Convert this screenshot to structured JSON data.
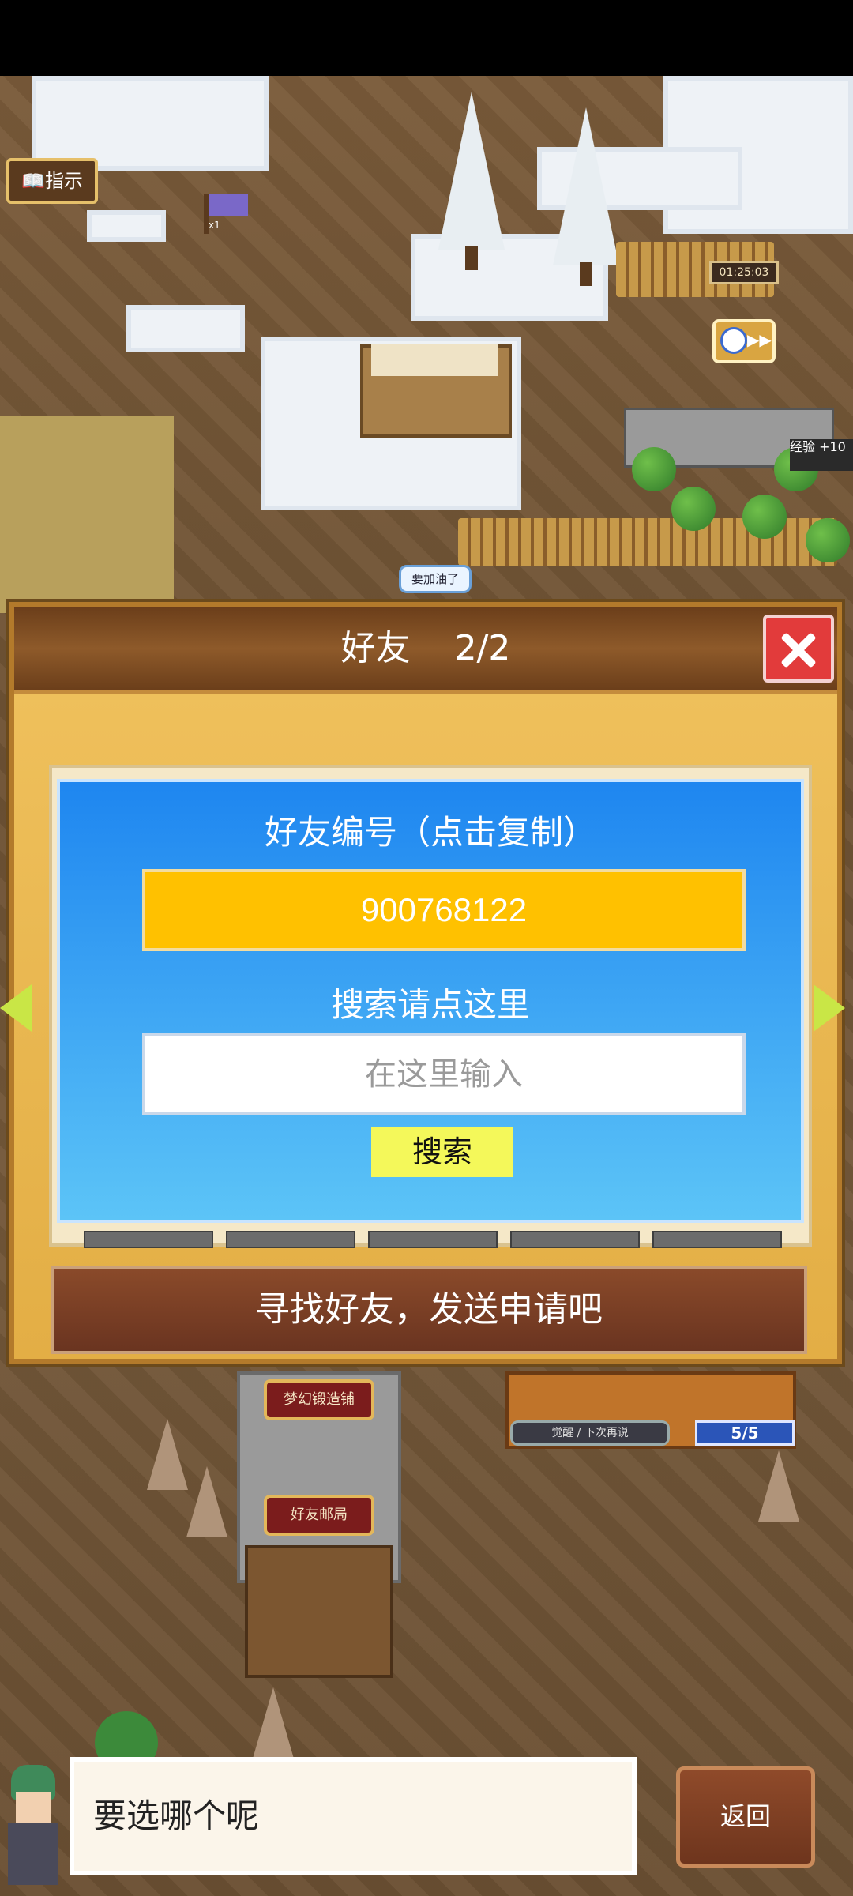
{
  "hud": {
    "guide_label": "指示",
    "timer": "01:25:03",
    "bubble": "要加油了",
    "exp_tag": "经验 +10",
    "flag_count": "x1"
  },
  "map_labels": {
    "forge": "梦幻锻造铺",
    "post_office": "好友邮局",
    "progress_text": "觉醒 / 下次再说",
    "count": "5/5"
  },
  "dialog": {
    "title": "好友",
    "title_count": "2/2",
    "id_label": "好友编号（点击复制）",
    "id_value": "900768122",
    "search_label": "搜索请点这里",
    "search_placeholder": "在这里输入",
    "search_button": "搜索",
    "find_button": "寻找好友，发送申请吧"
  },
  "bottom": {
    "prompt": "要选哪个呢",
    "back_button": "返回"
  }
}
